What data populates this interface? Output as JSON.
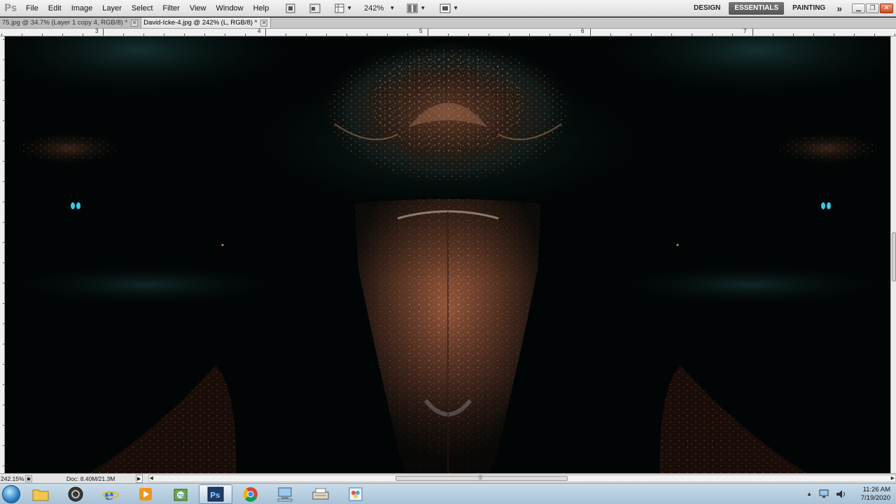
{
  "app": {
    "logo": "Ps",
    "menu": [
      "File",
      "Edit",
      "Image",
      "Layer",
      "Select",
      "Filter",
      "View",
      "Window",
      "Help"
    ],
    "zoom_value": "242%",
    "workspaces": [
      "DESIGN",
      "ESSENTIALS",
      "PAINTING"
    ],
    "active_workspace": "ESSENTIALS",
    "more_symbol": "»"
  },
  "tabs": [
    {
      "label": "75.jpg @ 34.7% (Layer 1 copy 4, RGB/8) *",
      "active": false
    },
    {
      "label": "David-Icke-4.jpg @ 242% (L, RGB/8) *",
      "active": true
    }
  ],
  "ruler": {
    "labels": [
      "3",
      "4",
      "5",
      "6",
      "7"
    ]
  },
  "status": {
    "zoom": "242.15%",
    "doc_size": "Doc: 8.40M/21.3M"
  },
  "taskbar": {
    "apps": [
      "folder-icon",
      "media-center-icon",
      "internet-explorer-icon",
      "media-player-icon",
      "hp-icon",
      "photoshop-icon",
      "chrome-icon",
      "network-computer-icon",
      "scanner-icon",
      "paint-icon"
    ],
    "active_app": "photoshop-icon",
    "time": "11:26 AM",
    "date": "7/19/2020"
  },
  "colors": {
    "canvas_bg": "#020505",
    "copper": "#b0603e",
    "teal_glow": "#0c2424",
    "cyan_eye": "#3fc6e8"
  }
}
